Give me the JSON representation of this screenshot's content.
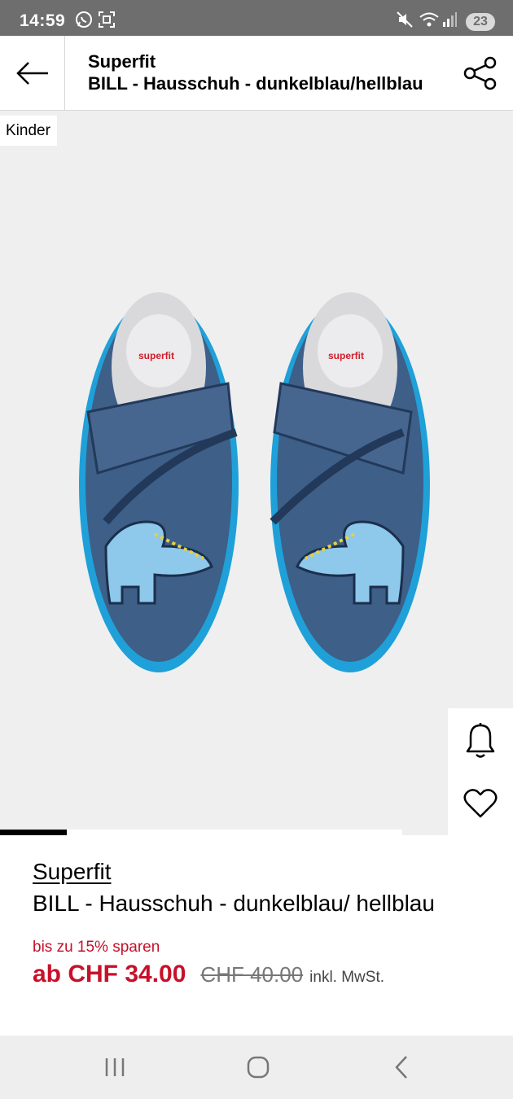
{
  "status_bar": {
    "time": "14:59",
    "left_icons": [
      "whatsapp-icon",
      "screenshot-icon"
    ],
    "right_icons": [
      "mute-icon",
      "wifi-icon",
      "signal-icon"
    ],
    "badge": "23"
  },
  "header": {
    "brand": "Superfit",
    "product_name": "BILL - Hausschuh - dunkelblau/hellblau"
  },
  "gallery": {
    "tag": "Kinder",
    "image": "product-photo-slippers",
    "progress": 0.166
  },
  "product": {
    "brand": "Superfit",
    "title": "BILL - Hausschuh - dunkelblau/ hellblau",
    "savings": "bis zu 15% sparen",
    "price_now": "ab CHF 34.00",
    "price_old": "CHF 40.00",
    "vat": "inkl. MwSt."
  },
  "colors": {
    "sale_red": "#c7112a",
    "status_bar": "#6e6e6e",
    "image_bg": "#efefef"
  }
}
